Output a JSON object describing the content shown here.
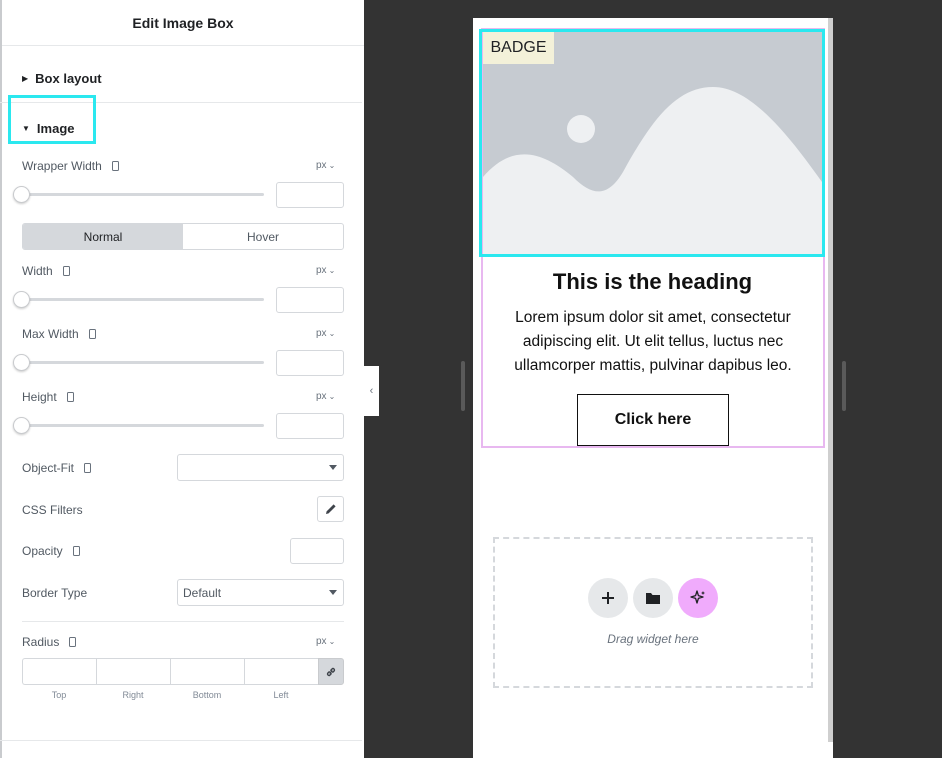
{
  "panel": {
    "title": "Edit Image Box",
    "sections": {
      "box_layout": "Box layout",
      "image": "Image"
    },
    "controls": {
      "wrapper_width": {
        "label": "Wrapper Width",
        "unit": "px",
        "value": ""
      },
      "state_tabs": [
        "Normal",
        "Hover"
      ],
      "active_state": "Normal",
      "width": {
        "label": "Width",
        "unit": "px",
        "value": ""
      },
      "max_width": {
        "label": "Max Width",
        "unit": "px",
        "value": ""
      },
      "height": {
        "label": "Height",
        "unit": "px",
        "value": ""
      },
      "object_fit": {
        "label": "Object-Fit",
        "value": ""
      },
      "css_filters": {
        "label": "CSS Filters"
      },
      "opacity": {
        "label": "Opacity",
        "value": ""
      },
      "border_type": {
        "label": "Border Type",
        "value": "Default"
      },
      "radius": {
        "label": "Radius",
        "unit": "px",
        "sides": [
          "Top",
          "Right",
          "Bottom",
          "Left"
        ]
      }
    }
  },
  "canvas": {
    "badge": "BADGE",
    "heading": "This is the heading",
    "description": "Lorem ipsum dolor sit amet, consectetur adipiscing elit. Ut elit tellus, luctus nec ullamcorper mattis, pulvinar dapibus leo.",
    "button_label": "Click here",
    "dropzone_label": "Drag widget here"
  },
  "icons": {
    "collapse": "chevron-left-icon",
    "device": "mobile-device-icon",
    "pencil": "pencil-icon",
    "link": "link-icon",
    "add": "plus-icon",
    "folder": "folder-icon",
    "ai": "sparkle-icon"
  },
  "colors": {
    "highlight": "#2ae8ef",
    "widget_outline": "#e8b8f0",
    "ai_button": "#f0abfc",
    "placeholder_image": "#c6cbd1"
  }
}
